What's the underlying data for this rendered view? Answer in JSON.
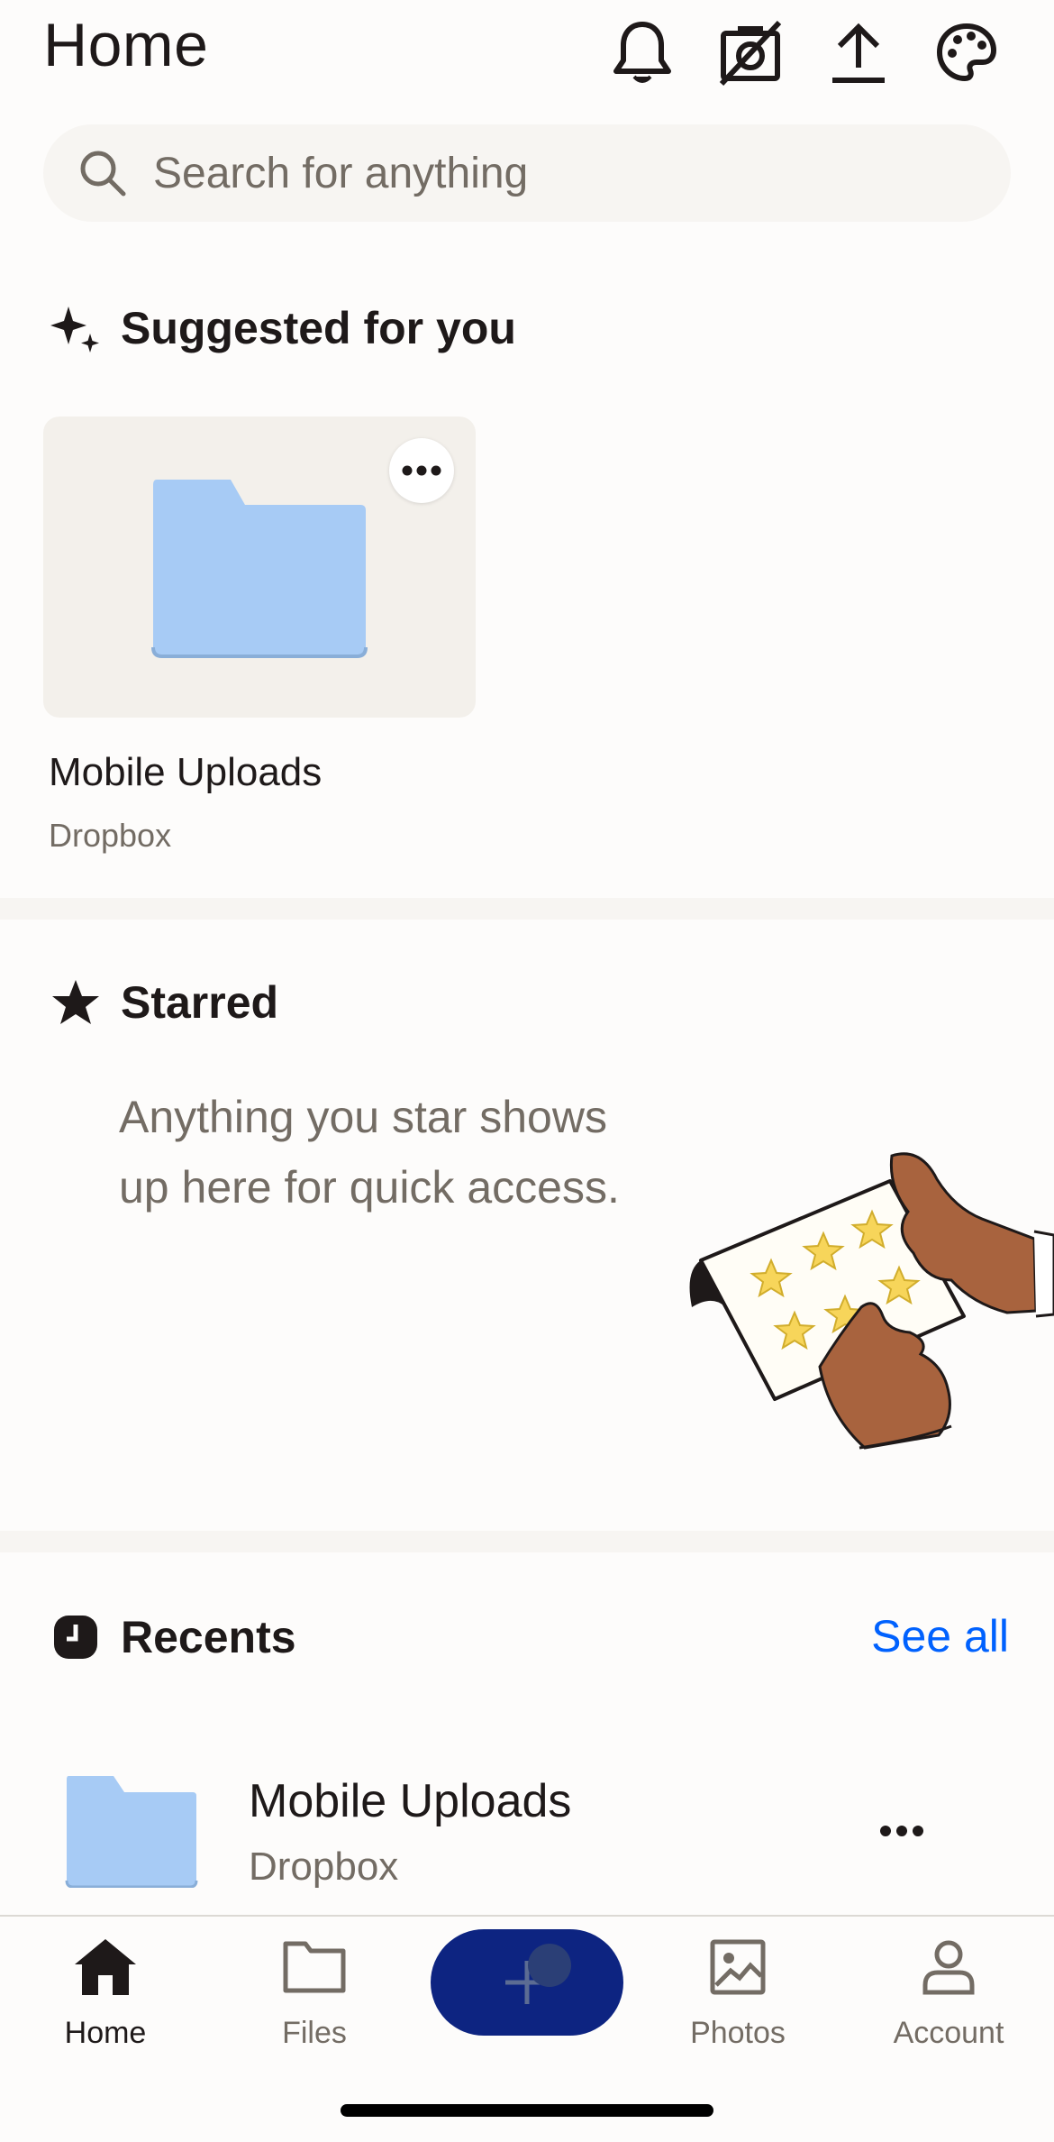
{
  "header": {
    "title": "Home"
  },
  "search": {
    "placeholder": "Search for anything"
  },
  "suggested": {
    "title": "Suggested for you",
    "items": [
      {
        "name": "Mobile Uploads",
        "location": "Dropbox"
      }
    ]
  },
  "starred": {
    "title": "Starred",
    "empty_message": "Anything you star shows up here for quick access."
  },
  "recents": {
    "title": "Recents",
    "see_all": "See all",
    "items": [
      {
        "name": "Mobile Uploads",
        "location": "Dropbox"
      }
    ]
  },
  "nav": {
    "items": [
      {
        "label": "Home",
        "icon": "home-icon",
        "active": true
      },
      {
        "label": "Files",
        "icon": "folder-icon"
      },
      {
        "label": "",
        "icon": "plus-icon"
      },
      {
        "label": "Photos",
        "icon": "photos-icon"
      },
      {
        "label": "Account",
        "icon": "account-icon"
      }
    ]
  },
  "colors": {
    "accent": "#0061fe",
    "fab": "#0d2481",
    "folder": "#a7cbf5"
  }
}
